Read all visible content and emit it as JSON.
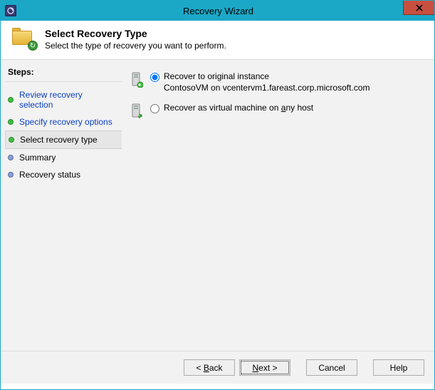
{
  "window": {
    "title": "Recovery Wizard"
  },
  "header": {
    "title": "Select Recovery Type",
    "subtitle": "Select the type of recovery you want to perform."
  },
  "sidebar": {
    "heading": "Steps:",
    "steps": [
      {
        "label": "Review recovery selection",
        "state": "done",
        "link": true
      },
      {
        "label": "Specify recovery options",
        "state": "done",
        "link": true
      },
      {
        "label": "Select recovery type",
        "state": "current",
        "link": false
      },
      {
        "label": "Summary",
        "state": "pending",
        "link": false
      },
      {
        "label": "Recovery status",
        "state": "pending",
        "link": false
      }
    ]
  },
  "options": {
    "original": {
      "label": "Recover to original instance",
      "detail": "ContosoVM on vcentervm1.fareast.corp.microsoft.com",
      "selected": true
    },
    "anyhost": {
      "label_pre": "Recover as virtual machine on ",
      "label_mn": "a",
      "label_post": "ny host",
      "selected": false
    }
  },
  "buttons": {
    "back_pre": "< ",
    "back_mn": "B",
    "back_post": "ack",
    "next_mn": "N",
    "next_post": "ext >",
    "cancel": "Cancel",
    "help": "Help"
  }
}
